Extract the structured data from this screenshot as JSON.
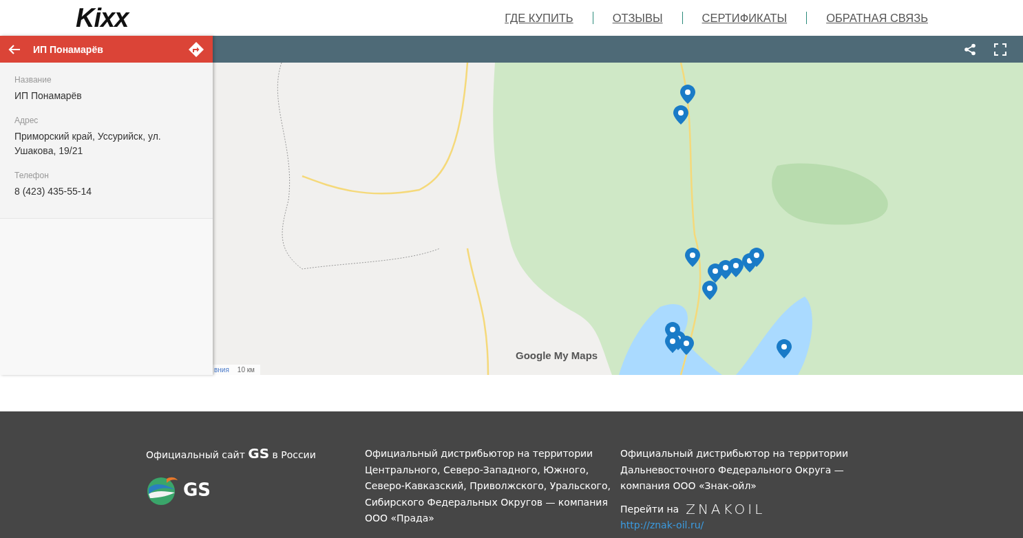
{
  "header": {
    "logo": "Kixx",
    "nav": [
      {
        "label": "ГДЕ КУПИТЬ"
      },
      {
        "label": "ОТЗЫВЫ"
      },
      {
        "label": "СЕРТИФИКАТЫ"
      },
      {
        "label": "ОБРАТНАЯ СВЯЗЬ"
      }
    ]
  },
  "map_panel": {
    "title": "ИП Понамарёв",
    "fields": [
      {
        "label": "Название",
        "value": "ИП Понамарёв"
      },
      {
        "label": "Адрес",
        "value": "Приморский край, Уссурийск, ул. Ушакова, 19/21"
      },
      {
        "label": "Телефон",
        "value": "8 (423) 435-55-14"
      }
    ]
  },
  "map": {
    "attribution": "вния",
    "scale": "10 км",
    "brand": "Google My Maps"
  },
  "footer": {
    "columns": [
      {
        "kind": "logo",
        "text": "Официальный сайт **GS** в России",
        "logo": "GS"
      },
      {
        "kind": "text",
        "text": "Официальный дистрибьютор на территории Центрального, Северо-Западного, Южного, Северо-Кавказский, Приволжского, Уральского, Сибирского Федеральных Округов — компания ООО «Прада»"
      },
      {
        "kind": "link",
        "text": "Официальный дистрибьютор на территории Дальневосточного Федерального Округа — компания ООО «Знак-ойл»",
        "goto": "Перейти на",
        "logo": "ZNAKOIL",
        "url": "http://znak-oil.ru/"
      }
    ]
  }
}
